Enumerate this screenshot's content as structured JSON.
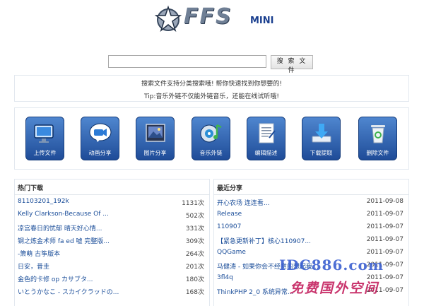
{
  "header": {
    "logo_text": "FFS",
    "logo_sub": "MINI"
  },
  "search": {
    "value": "",
    "button_label": "搜 索 文 件"
  },
  "notice": {
    "line1": "搜索文件支持分类搜索哦! 帮你快速找到你想要的!",
    "line2": "Tip:音乐外链不仅能外链音乐，还能在线试听哦!"
  },
  "toolbar": {
    "items": [
      {
        "label": "上传文件",
        "icon": "monitor-icon"
      },
      {
        "label": "动画分享",
        "icon": "video-camera-icon"
      },
      {
        "label": "图片分享",
        "icon": "photo-icon"
      },
      {
        "label": "音乐外链",
        "icon": "music-icon"
      },
      {
        "label": "编辑描述",
        "icon": "document-icon"
      },
      {
        "label": "下载提取",
        "icon": "download-icon"
      },
      {
        "label": "删除文件",
        "icon": "trash-icon"
      }
    ]
  },
  "hot": {
    "title": "热门下载",
    "rows": [
      {
        "name": "81103201_192k",
        "value": "1131次"
      },
      {
        "name": "Kelly Clarkson-Because Of ...",
        "value": "502次"
      },
      {
        "name": "凉宫春日的忧郁 晴天好心情...",
        "value": "331次"
      },
      {
        "name": "钢之炼金术师 fa ed 嘘 完整版...",
        "value": "309次"
      },
      {
        "name": "-箫萌 古筝版本",
        "value": "264次"
      },
      {
        "name": "日安，昔圭",
        "value": "201次"
      },
      {
        "name": "金色的卡修 op カサブタ...",
        "value": "180次"
      },
      {
        "name": "いとうかなこ - スカイクラッドの...",
        "value": "168次"
      }
    ]
  },
  "latest": {
    "title": "最近分享",
    "rows": [
      {
        "name": "开心农场 连连看...",
        "value": "2011-09-08"
      },
      {
        "name": "Release",
        "value": "2011-09-07"
      },
      {
        "name": "110907",
        "value": "2011-09-07"
      },
      {
        "name": "【紧急更新补丁】核心110907...",
        "value": "2011-09-07"
      },
      {
        "name": "QQGame",
        "value": "2011-09-07"
      },
      {
        "name": "马健涛 - 如果你会不经意的想起我...",
        "value": "2011-09-07"
      },
      {
        "name": "3fl4q",
        "value": "2011-09-07"
      },
      {
        "name": "ThinkPHP 2_0 系统异常...",
        "value": "2011-09-07"
      }
    ]
  },
  "watermark": {
    "line1": "IDC886.com",
    "line2": "免费国外空间"
  }
}
